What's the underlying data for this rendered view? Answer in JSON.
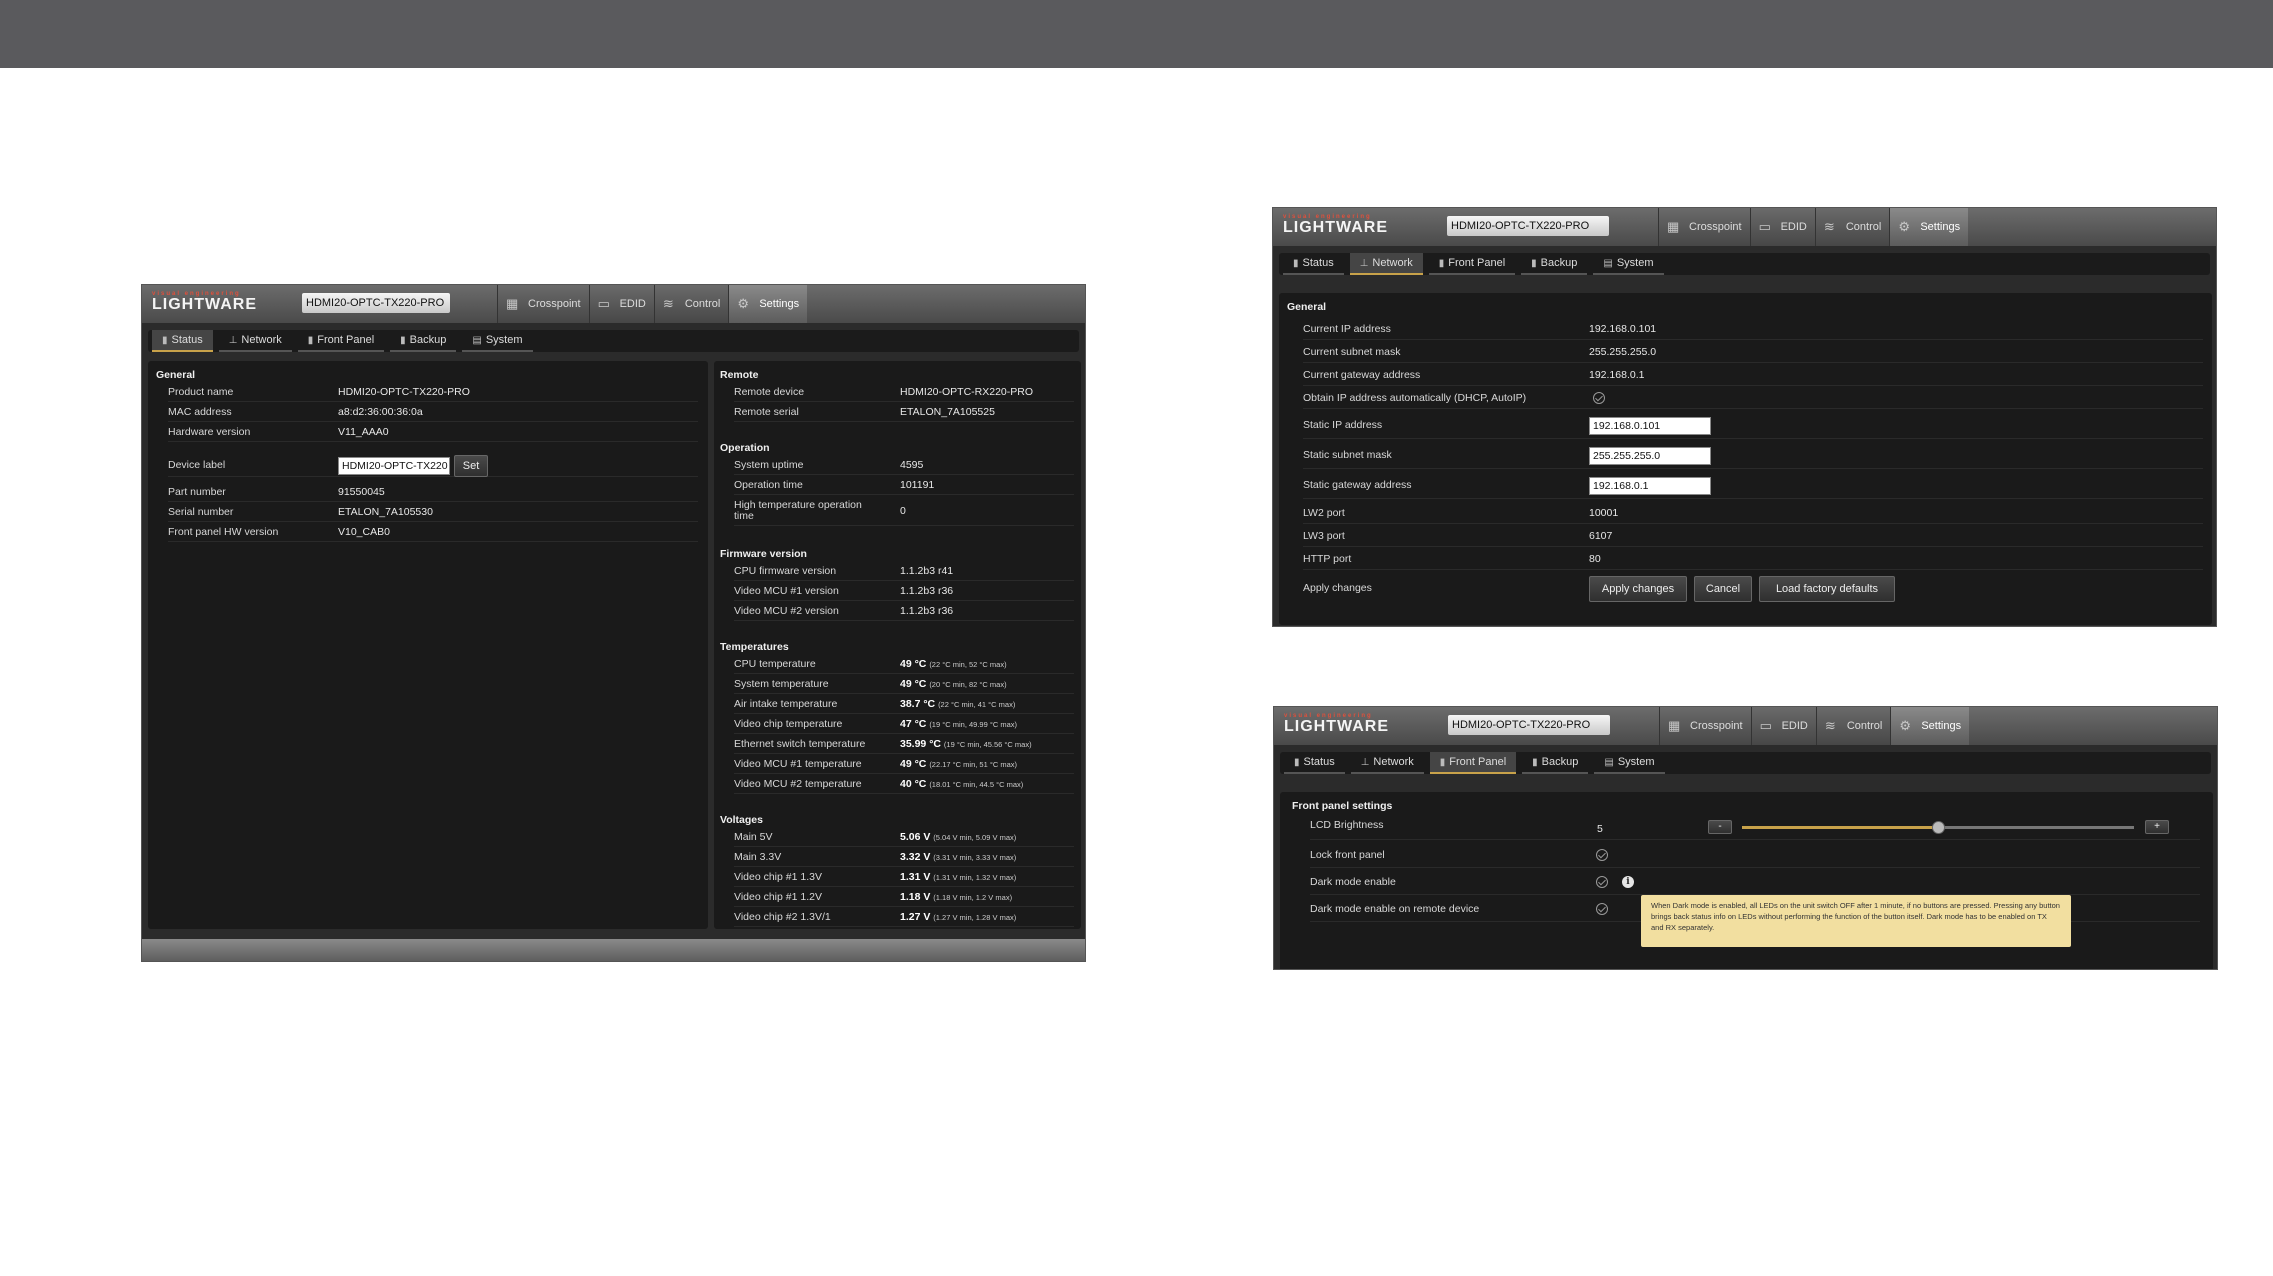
{
  "app": {
    "brand_small": "visual engineering",
    "brand": "LIGHTWARE",
    "device_name": "HDMI20-OPTC-TX220-PRO"
  },
  "main_tabs": [
    "Crosspoint",
    "EDID",
    "Control",
    "Settings"
  ],
  "sub_tabs": [
    "Status",
    "Network",
    "Front Panel",
    "Backup",
    "System"
  ],
  "status": {
    "general_title": "General",
    "rows": [
      {
        "label": "Product name",
        "value": "HDMI20-OPTC-TX220-PRO"
      },
      {
        "label": "MAC address",
        "value": "a8:d2:36:00:36:0a"
      },
      {
        "label": "Hardware version",
        "value": "V11_AAA0"
      }
    ],
    "device_label": {
      "label": "Device label",
      "value": "HDMI20-OPTC-TX220",
      "button": "Set"
    },
    "rows2": [
      {
        "label": "Part number",
        "value": "91550045"
      },
      {
        "label": "Serial number",
        "value": "ETALON_7A105530"
      },
      {
        "label": "Front panel HW version",
        "value": "V10_CAB0"
      }
    ],
    "remote_title": "Remote",
    "remote": [
      {
        "label": "Remote device",
        "value": "HDMI20-OPTC-RX220-PRO"
      },
      {
        "label": "Remote serial",
        "value": "ETALON_7A105525"
      }
    ],
    "operation_title": "Operation",
    "operation": [
      {
        "label": "System uptime",
        "value": "4595"
      },
      {
        "label": "Operation time",
        "value": "101191"
      },
      {
        "label": "High temperature operation time",
        "value": "0"
      }
    ],
    "firmware_title": "Firmware version",
    "firmware": [
      {
        "label": "CPU firmware version",
        "value": "1.1.2b3 r41"
      },
      {
        "label": "Video MCU #1 version",
        "value": "1.1.2b3 r36"
      },
      {
        "label": "Video MCU #2 version",
        "value": "1.1.2b3 r36"
      }
    ],
    "temps_title": "Temperatures",
    "temps": [
      {
        "label": "CPU temperature",
        "value": "49 °C",
        "detail": "(22 °C min, 52 °C max)"
      },
      {
        "label": "System temperature",
        "value": "49 °C",
        "detail": "(20 °C min, 82 °C max)"
      },
      {
        "label": "Air intake temperature",
        "value": "38.7 °C",
        "detail": "(22 °C min, 41 °C max)"
      },
      {
        "label": "Video chip temperature",
        "value": "47 °C",
        "detail": "(19 °C min, 49.99 °C max)"
      },
      {
        "label": "Ethernet switch temperature",
        "value": "35.99 °C",
        "detail": "(19 °C min, 45.56 °C max)"
      },
      {
        "label": "Video MCU #1 temperature",
        "value": "49 °C",
        "detail": "(22.17 °C min, 51 °C max)"
      },
      {
        "label": "Video MCU #2 temperature",
        "value": "40 °C",
        "detail": "(18.01 °C min, 44.5 °C max)"
      }
    ],
    "volt_title": "Voltages",
    "volts": [
      {
        "label": "Main 5V",
        "value": "5.06 V",
        "detail": "(5.04 V min, 5.09 V max)"
      },
      {
        "label": "Main 3.3V",
        "value": "3.32 V",
        "detail": "(3.31 V min, 3.33 V max)"
      },
      {
        "label": "Video chip #1 1.3V",
        "value": "1.31 V",
        "detail": "(1.31 V min, 1.32 V max)"
      },
      {
        "label": "Video chip #1 1.2V",
        "value": "1.18 V",
        "detail": "(1.18 V min, 1.2 V max)"
      },
      {
        "label": "Video chip #2 1.3V/1",
        "value": "1.27 V",
        "detail": "(1.27 V min, 1.28 V max)"
      }
    ]
  },
  "network": {
    "title": "General",
    "current_ip": {
      "label": "Current IP address",
      "value": "192.168.0.101"
    },
    "current_mask": {
      "label": "Current subnet mask",
      "value": "255.255.255.0"
    },
    "current_gw": {
      "label": "Current gateway address",
      "value": "192.168.0.1"
    },
    "dhcp": {
      "label": "Obtain IP address automatically (DHCP, AutoIP)"
    },
    "static_ip": {
      "label": "Static IP address",
      "value": "192.168.0.101"
    },
    "static_mask": {
      "label": "Static subnet mask",
      "value": "255.255.255.0"
    },
    "static_gw": {
      "label": "Static gateway address",
      "value": "192.168.0.1"
    },
    "lw2": {
      "label": "LW2 port",
      "value": "10001"
    },
    "lw3": {
      "label": "LW3 port",
      "value": "6107"
    },
    "http": {
      "label": "HTTP port",
      "value": "80"
    },
    "apply": {
      "label": "Apply changes",
      "apply_btn": "Apply changes",
      "cancel_btn": "Cancel",
      "factory_btn": "Load factory defaults"
    }
  },
  "front_panel": {
    "title": "Front panel settings",
    "lcd": {
      "label": "LCD Brightness",
      "value": "5",
      "minus": "-",
      "plus": "+",
      "level": 0.5
    },
    "lock": {
      "label": "Lock front panel"
    },
    "dark": {
      "label": "Dark mode enable"
    },
    "dark_remote": {
      "label": "Dark mode enable on remote device"
    },
    "tooltip": "When Dark mode is enabled, all LEDs on the unit switch OFF after 1 minute, if no buttons are pressed. Pressing any button brings back status info on LEDs without performing the function of the button itself. Dark mode has to be enabled on TX and RX separately."
  },
  "colors": {
    "accent": "#c8a24a",
    "brand_red": "#e0503c",
    "tooltip": "#f2dfa0"
  }
}
